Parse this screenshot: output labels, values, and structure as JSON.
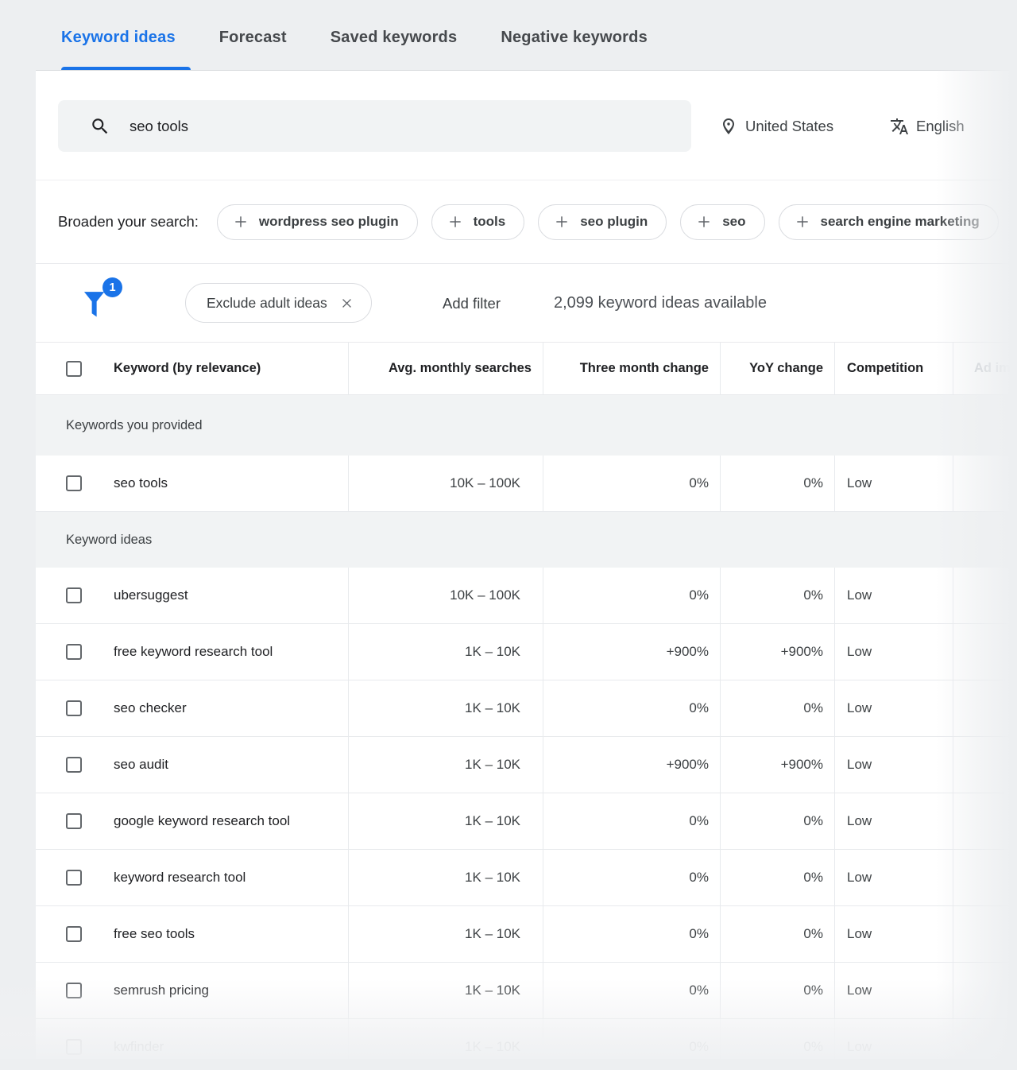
{
  "tabs": {
    "items": [
      {
        "label": "Keyword ideas"
      },
      {
        "label": "Forecast"
      },
      {
        "label": "Saved keywords"
      },
      {
        "label": "Negative keywords"
      }
    ]
  },
  "search": {
    "query": "seo tools",
    "location": "United States",
    "language": "English"
  },
  "broaden": {
    "label": "Broaden your search:",
    "chips": [
      {
        "label": "wordpress seo plugin"
      },
      {
        "label": "tools"
      },
      {
        "label": "seo plugin"
      },
      {
        "label": "seo"
      },
      {
        "label": "search engine marketing"
      }
    ]
  },
  "filterbar": {
    "badge": "1",
    "filter_chip": "Exclude adult ideas",
    "add_filter": "Add filter",
    "available": "2,099 keyword ideas available"
  },
  "table": {
    "columns": {
      "keyword": "Keyword (by relevance)",
      "avg": "Avg. monthly searches",
      "three_month": "Three month change",
      "yoy": "YoY change",
      "competition": "Competition",
      "ad_share": "Ad impression share"
    },
    "sections": [
      {
        "header": "Keywords you provided",
        "rows": [
          {
            "keyword": "seo tools",
            "avg": "10K – 100K",
            "three_month": "0%",
            "yoy": "0%",
            "competition": "Low"
          }
        ]
      },
      {
        "header": "Keyword ideas",
        "rows": [
          {
            "keyword": "ubersuggest",
            "avg": "10K – 100K",
            "three_month": "0%",
            "yoy": "0%",
            "competition": "Low"
          },
          {
            "keyword": "free keyword research tool",
            "avg": "1K – 10K",
            "three_month": "+900%",
            "yoy": "+900%",
            "competition": "Low"
          },
          {
            "keyword": "seo checker",
            "avg": "1K – 10K",
            "three_month": "0%",
            "yoy": "0%",
            "competition": "Low"
          },
          {
            "keyword": "seo audit",
            "avg": "1K – 10K",
            "three_month": "+900%",
            "yoy": "+900%",
            "competition": "Low"
          },
          {
            "keyword": "google keyword research tool",
            "avg": "1K – 10K",
            "three_month": "0%",
            "yoy": "0%",
            "competition": "Low"
          },
          {
            "keyword": "keyword research tool",
            "avg": "1K – 10K",
            "three_month": "0%",
            "yoy": "0%",
            "competition": "Low"
          },
          {
            "keyword": "free seo tools",
            "avg": "1K – 10K",
            "three_month": "0%",
            "yoy": "0%",
            "competition": "Low"
          },
          {
            "keyword": "semrush pricing",
            "avg": "1K – 10K",
            "three_month": "0%",
            "yoy": "0%",
            "competition": "Low"
          },
          {
            "keyword": "kwfinder",
            "avg": "1K – 10K",
            "three_month": "0%",
            "yoy": "0%",
            "competition": "Low"
          }
        ]
      }
    ]
  },
  "colors": {
    "accent": "#1a73e8"
  }
}
